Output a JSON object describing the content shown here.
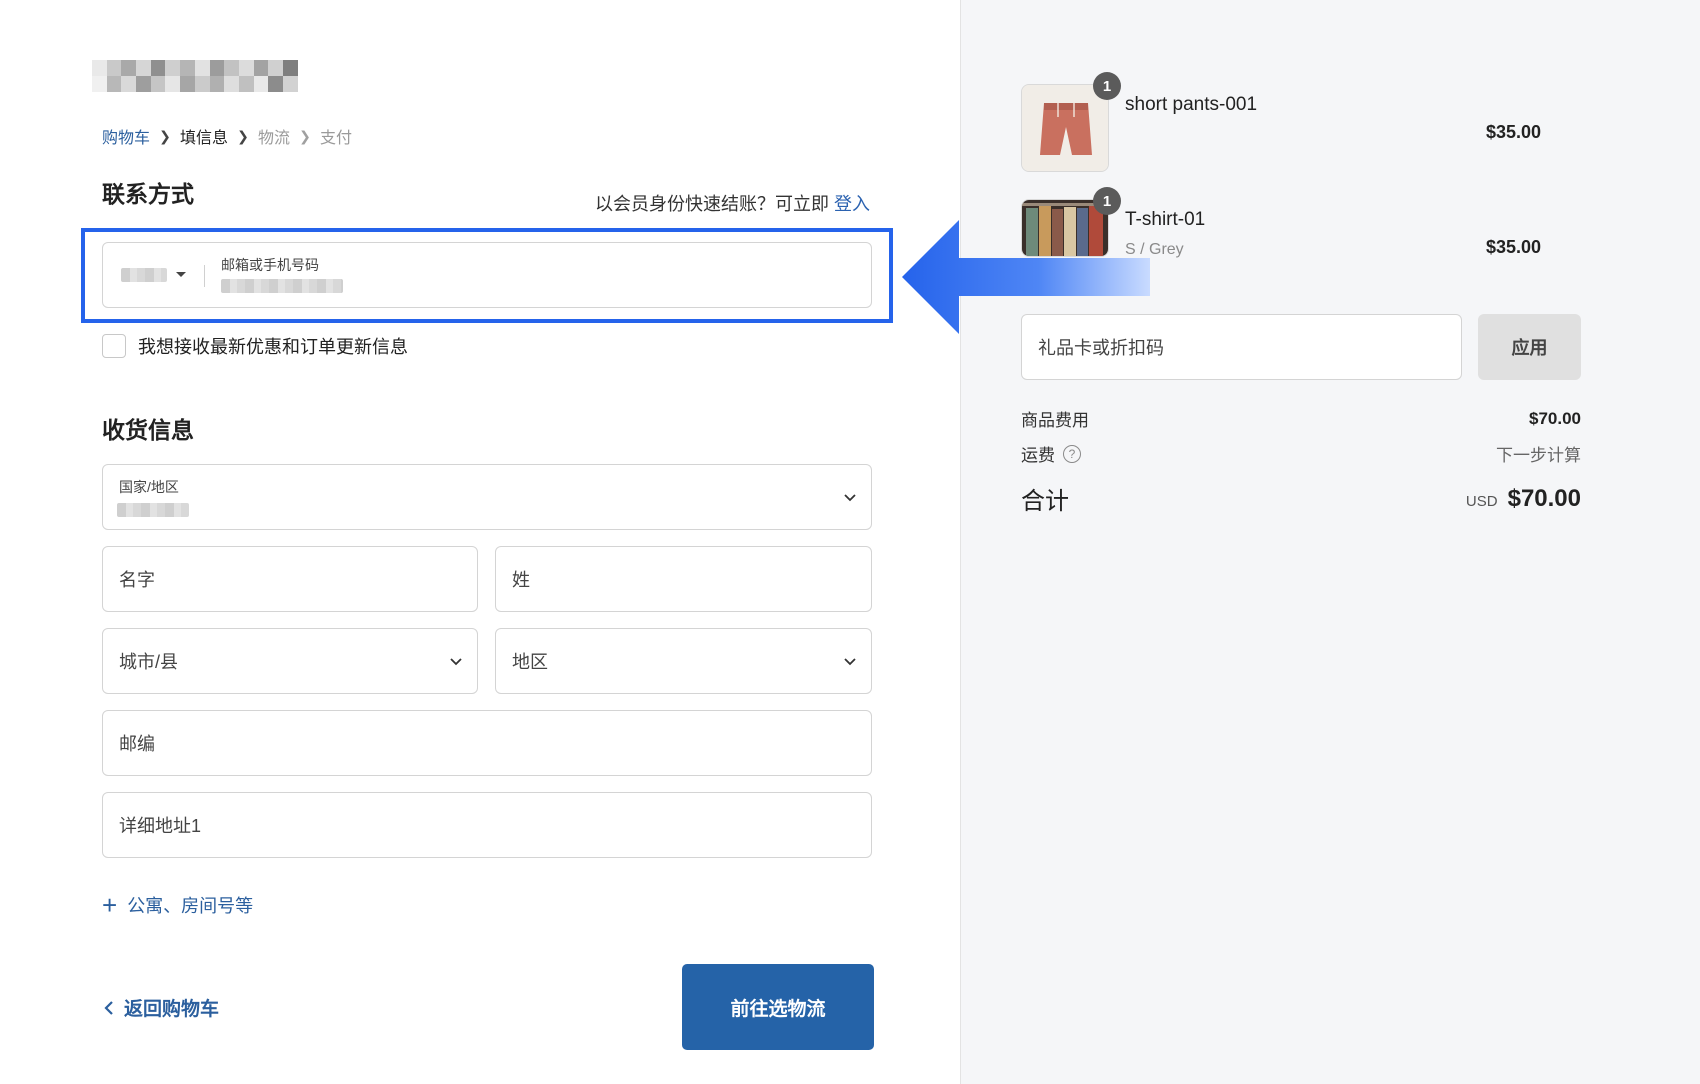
{
  "breadcrumb": {
    "cart": "购物车",
    "info": "填信息",
    "shipping": "物流",
    "payment": "支付"
  },
  "contact": {
    "title": "联系方式",
    "login_prompt": "以会员身份快速结账？可立即",
    "login_link": "登入",
    "field_label": "邮箱或手机号码",
    "newsletter_label": "我想接收最新优惠和订单更新信息"
  },
  "shipping": {
    "title": "收货信息",
    "country_label": "国家/地区",
    "first_name_placeholder": "名字",
    "last_name_placeholder": "姓",
    "city_placeholder": "城市/县",
    "region_placeholder": "地区",
    "zip_placeholder": "邮编",
    "address1_placeholder": "详细地址1",
    "add_address2_label": "公寓、房间号等"
  },
  "footer": {
    "back_label": "返回购物车",
    "continue_label": "前往选物流"
  },
  "summary": {
    "items": [
      {
        "name": "short pants-001",
        "variant": "",
        "quantity": "1",
        "price": "$35.00"
      },
      {
        "name": "T-shirt-01",
        "variant": "S / Grey",
        "quantity": "1",
        "price": "$35.00"
      }
    ],
    "discount_placeholder": "礼品卡或折扣码",
    "apply_label": "应用",
    "subtotal_label": "商品费用",
    "subtotal_value": "$70.00",
    "shipping_label": "运费",
    "shipping_value": "下一步计算",
    "total_label": "合计",
    "currency": "USD",
    "total_value": "$70.00"
  },
  "colors": {
    "accent": "#2563a8",
    "link": "#2b5f9e",
    "highlight": "#2563eb",
    "sidebar_bg": "#f5f6f8"
  }
}
